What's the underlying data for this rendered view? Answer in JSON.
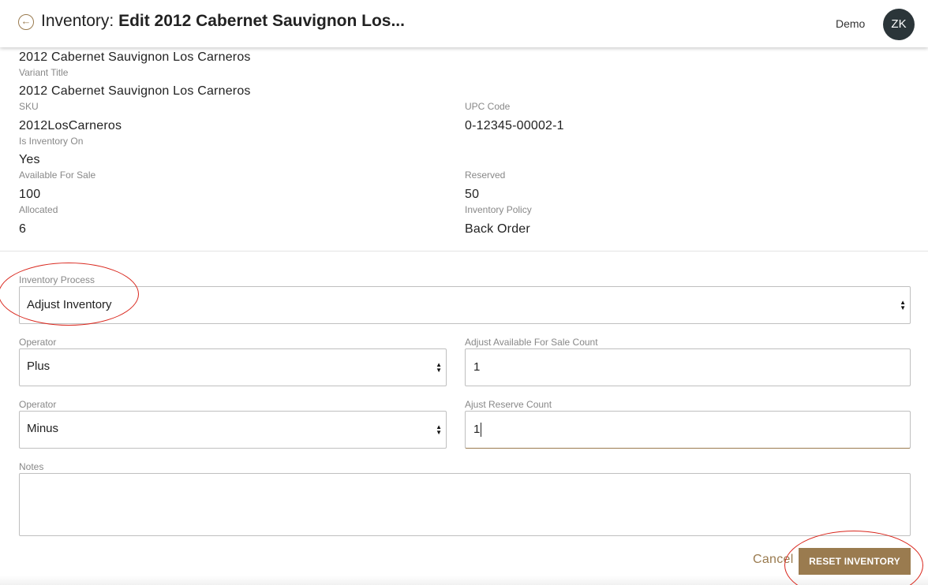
{
  "header": {
    "back_icon": "arrow-left-circle-icon",
    "title_prefix": "Inventory: ",
    "title_main": "Edit 2012 Cabernet Sauvignon Los...",
    "account_name": "Demo",
    "avatar_initials": "ZK"
  },
  "details": {
    "product_title": "2012 Cabernet Sauvignon Los Carneros",
    "variant_title_label": "Variant Title",
    "variant_title": "2012 Cabernet Sauvignon Los Carneros",
    "sku_label": "SKU",
    "sku": "2012LosCarneros",
    "upc_label": "UPC Code",
    "upc": "0-12345-00002-1",
    "is_inventory_on_label": "Is Inventory On",
    "is_inventory_on": "Yes",
    "available_label": "Available For Sale",
    "available": "100",
    "reserved_label": "Reserved",
    "reserved": "50",
    "allocated_label": "Allocated",
    "allocated": "6",
    "policy_label": "Inventory Policy",
    "policy": "Back Order"
  },
  "form": {
    "process_label": "Inventory Process",
    "process_value": "Adjust Inventory",
    "operator1_label": "Operator",
    "operator1_value": "Plus",
    "adjust_available_label": "Adjust Available For Sale Count",
    "adjust_available_value": "1",
    "operator2_label": "Operator",
    "operator2_value": "Minus",
    "adjust_reserve_label": "Ajust Reserve Count",
    "adjust_reserve_value": "1",
    "notes_label": "Notes",
    "notes_value": ""
  },
  "actions": {
    "cancel_label": "Cancel",
    "reset_label": "RESET INVENTORY"
  },
  "colors": {
    "accent": "#9a7b4f",
    "avatar_bg": "#2b3539",
    "annotation": "#d9261c"
  }
}
